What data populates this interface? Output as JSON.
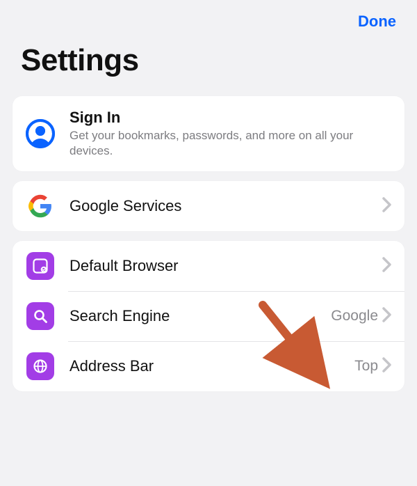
{
  "header": {
    "done_label": "Done",
    "title": "Settings"
  },
  "groups": {
    "account": {
      "signin_label": "Sign In",
      "signin_subtitle": "Get your bookmarks, passwords, and more on all your devices."
    },
    "services": {
      "google_services_label": "Google Services"
    },
    "prefs": {
      "default_browser_label": "Default Browser",
      "search_engine_label": "Search Engine",
      "search_engine_value": "Google",
      "address_bar_label": "Address Bar",
      "address_bar_value": "Top"
    }
  },
  "annotation": {
    "arrow_color": "#c85a33"
  }
}
